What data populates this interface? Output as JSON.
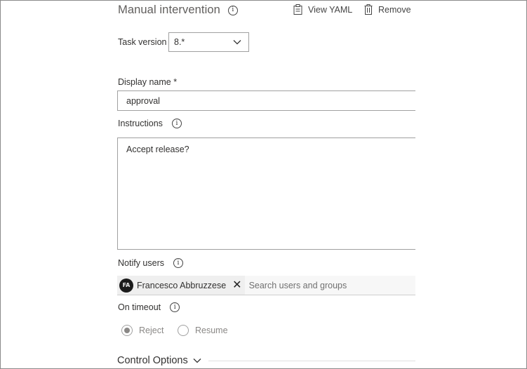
{
  "header": {
    "title": "Manual intervention",
    "view_yaml_label": "View YAML",
    "remove_label": "Remove"
  },
  "task_version": {
    "label": "Task version",
    "value": "8.*"
  },
  "display_name": {
    "label": "Display name *",
    "value": "approval"
  },
  "instructions": {
    "label": "Instructions",
    "value": "Accept release?"
  },
  "notify_users": {
    "label": "Notify users",
    "selected_user": "Francesco Abbruzzese",
    "avatar_initials": "FA",
    "placeholder": "Search users and groups"
  },
  "on_timeout": {
    "label": "On timeout",
    "options": [
      {
        "label": "Reject",
        "selected": true
      },
      {
        "label": "Resume",
        "selected": false
      }
    ]
  },
  "control_options": {
    "label": "Control Options"
  },
  "colors": {
    "text": "#323130",
    "muted": "#605e5c",
    "border": "#a0a0a0"
  }
}
